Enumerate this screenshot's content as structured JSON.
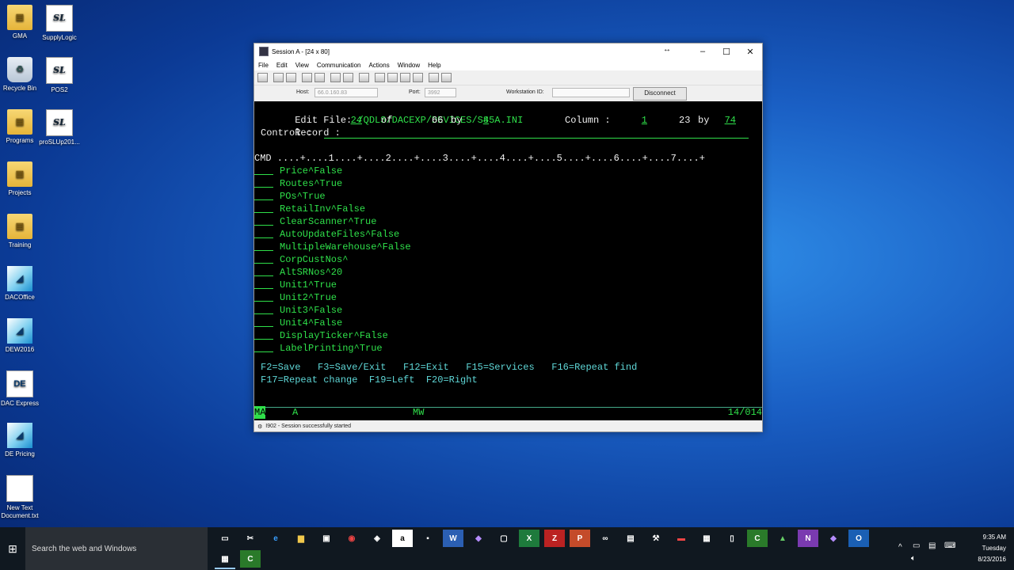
{
  "desktop": {
    "icons": [
      {
        "label": "GMA",
        "icon": "folder-icon"
      },
      {
        "label": "SupplyLogic",
        "icon": "supplylogic-icon"
      },
      {
        "label": "Recycle Bin",
        "icon": "recycle-bin-icon"
      },
      {
        "label": "POS2",
        "icon": "pos-icon"
      },
      {
        "label": "Programs",
        "icon": "folder-icon"
      },
      {
        "label": "proSLUp201...",
        "icon": "supplylogic-icon"
      },
      {
        "label": "Projects",
        "icon": "folder-icon"
      },
      {
        "label": "Training",
        "icon": "folder-icon"
      },
      {
        "label": "DACOffice",
        "icon": "dac-icon"
      },
      {
        "label": "DEW2016",
        "icon": "dac-icon"
      },
      {
        "label": "DAC Express",
        "icon": "dac-express-icon"
      },
      {
        "label": "DE Pricing",
        "icon": "dac-icon"
      },
      {
        "label": "New Text Document.txt",
        "icon": "text-file-icon"
      }
    ]
  },
  "window": {
    "title": "Session A - [24 x 80]",
    "menu": [
      "File",
      "Edit",
      "View",
      "Communication",
      "Actions",
      "Window",
      "Help"
    ],
    "host_label": "Host:",
    "host_value": "66.0.160.83",
    "port_label": "Port:",
    "port_value": "3992",
    "workstation_label": "Workstation ID:",
    "workstation_value": "",
    "disconnect_label": "Disconnect",
    "status_message": "I902 - Session successfully started"
  },
  "terminal": {
    "edit_file_label": "Edit File: ",
    "edit_file_path": "/QDLS/DACEXP/DEVICES/S45A.INI",
    "record_label": "Record : ",
    "record_value": "24",
    "of_label": "of",
    "record_total": "66",
    "by_label": "by",
    "record_by": "8",
    "column_label": "Column : ",
    "column_value": "1",
    "column_range_start": "23",
    "column_by": "74",
    "control_label": "Control : ",
    "ruler": "CMD ....+....1....+....2....+....3....+....4....+....5....+....6....+....7....+",
    "lines": [
      "Price^False",
      "Routes^True",
      "POs^True",
      "RetailInv^False",
      "ClearScanner^True",
      "AutoUpdateFiles^False",
      "MultipleWarehouse^False",
      "CorpCustNos^",
      "AltSRNos^20",
      "Unit1^True",
      "Unit2^True",
      "Unit3^False",
      "Unit4^False",
      "DisplayTicker^False",
      "LabelPrinting^True"
    ],
    "fkeys_line1": "F2=Save   F3=Save/Exit   F12=Exit   F15=Services   F16=Repeat find",
    "fkeys_line2": "F17=Repeat change  F19=Left  F20=Right",
    "oia_left": "MA",
    "oia_a": "A",
    "oia_mw": "MW",
    "oia_cursor": "14/014"
  },
  "taskbar": {
    "search_placeholder": "Search the web and Windows",
    "time": "9:35 AM",
    "day": "Tuesday",
    "date": "8/23/2016"
  },
  "colors": {
    "terminal_green": "#2fe04a",
    "terminal_bg": "#000000"
  }
}
